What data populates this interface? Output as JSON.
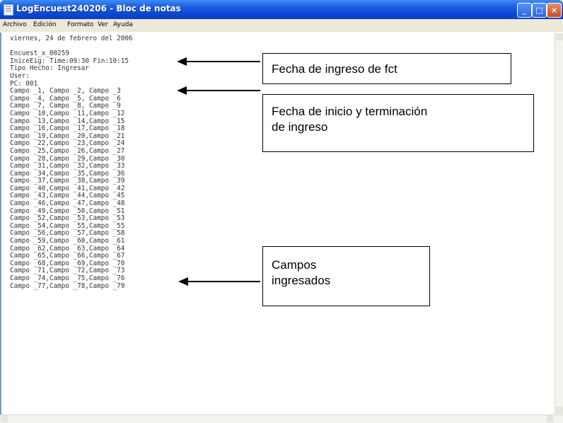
{
  "window": {
    "title": "LogEncuest240206 - Bloc de notas",
    "buttons": {
      "minimize": "_",
      "maximize": "□",
      "close": "×"
    }
  },
  "menu": [
    "Archivo",
    "Edición",
    "Formato",
    "Ver",
    "Ayuda"
  ],
  "document": {
    "lines": [
      "viernes, 24 de febrero del 2006",
      "",
      "Encuest_x_00259",
      "IniceEig: Time:09:30 Fin:10:15",
      "Tipo Hecho: Ingresar",
      "User:",
      "PC: 001",
      "Campo _1, Campo _2, Campo _3",
      "Campo _4, Campo _5, Campo _6",
      "Campo _7, Campo _8, Campo _9",
      "Campo _10,Campo _11,Campo _12",
      "Campo _13,Campo _14,Campo _15",
      "Campo _16,Campo _17,Campo _18",
      "Campo _19,Campo _20,Campo _21",
      "Campo _22,Campo _23,Campo _24",
      "Campo _25,Campo _26,Campo _27",
      "Campo _28,Campo _29,Campo _30",
      "Campo _31,Campo _32,Campo _33",
      "Campo _34,Campo _35,Campo _36",
      "Campo _37,Campo _38,Campo _39",
      "Campo _40,Campo _41,Campo _42",
      "Campo _43,Campo _44,Campo _45",
      "Campo _46,Campo _47,Campo _48",
      "Campo _49,Campo _50,Campo _51",
      "Campo _52,Campo _53,Campo _53",
      "Campo _54,Campo _55,Campo _55",
      "Campo _56,Campo _57,Campo _58",
      "Campo _59,Campo _60,Campo _61",
      "Campo _62,Campo _63,Campo _64",
      "Campo _65,Campo _66,Campo _67",
      "Campo _68,Campo _69,Campo _70",
      "Campo _71,Campo _72,Campo _73",
      "Campo _74,Campo _75,Campo _76",
      "Campo _77,Campo _78,Campo _79"
    ]
  },
  "callouts": {
    "fecha_ingreso": "Fecha de ingreso de fct",
    "fecha_inicio_line1": "Fecha de inicio y terminación",
    "fecha_inicio_line2": "de ingreso",
    "campos_line1": "Campos",
    "campos_line2": "ingresados"
  },
  "icons": {
    "app": "notepad-icon",
    "arrow": "left-arrow-icon"
  }
}
